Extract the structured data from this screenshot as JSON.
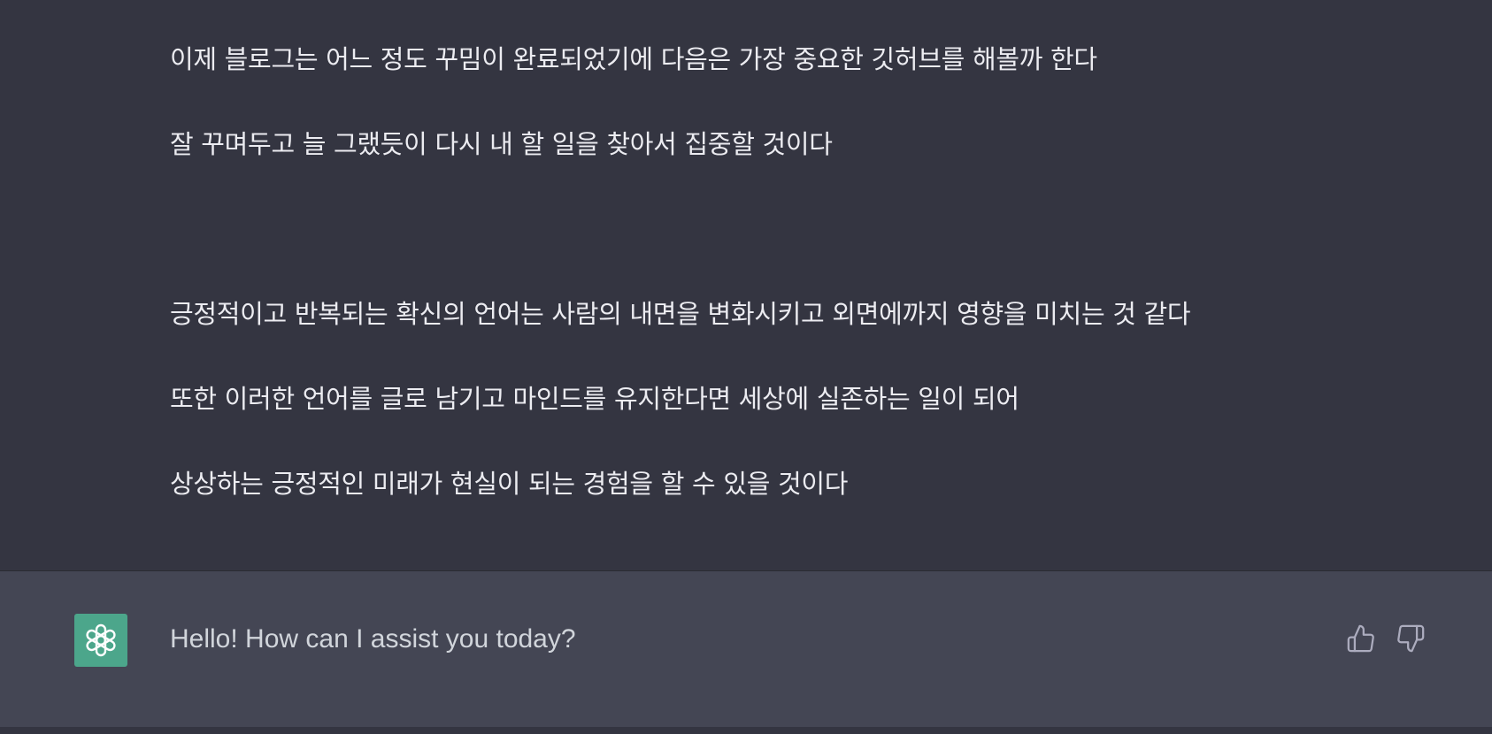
{
  "conversation": {
    "user_message": {
      "lines": [
        "이제 블로그는 어느 정도 꾸밈이 완료되었기에 다음은 가장 중요한 깃허브를 해볼까 한다",
        "잘 꾸며두고 늘 그랬듯이 다시 내 할 일을 찾아서 집중할 것이다",
        "",
        "긍정적이고 반복되는 확신의 언어는 사람의 내면을 변화시키고 외면에까지 영향을 미치는 것 같다",
        "또한 이러한 언어를 글로 남기고 마인드를 유지한다면 세상에 실존하는 일이 되어",
        "상상하는 긍정적인 미래가 현실이 되는 경험을 할 수 있을 것이다"
      ]
    },
    "assistant_message": {
      "avatar_icon": "openai-logo-icon",
      "avatar_color": "#4ca68b",
      "text": "Hello! How can I assist you today?"
    },
    "feedback": {
      "like_icon": "thumbs-up-icon",
      "dislike_icon": "thumbs-down-icon"
    }
  },
  "colors": {
    "user_bg": "#343541",
    "assistant_bg": "#444654",
    "text": "#ececf1",
    "icon": "#acacbe"
  }
}
